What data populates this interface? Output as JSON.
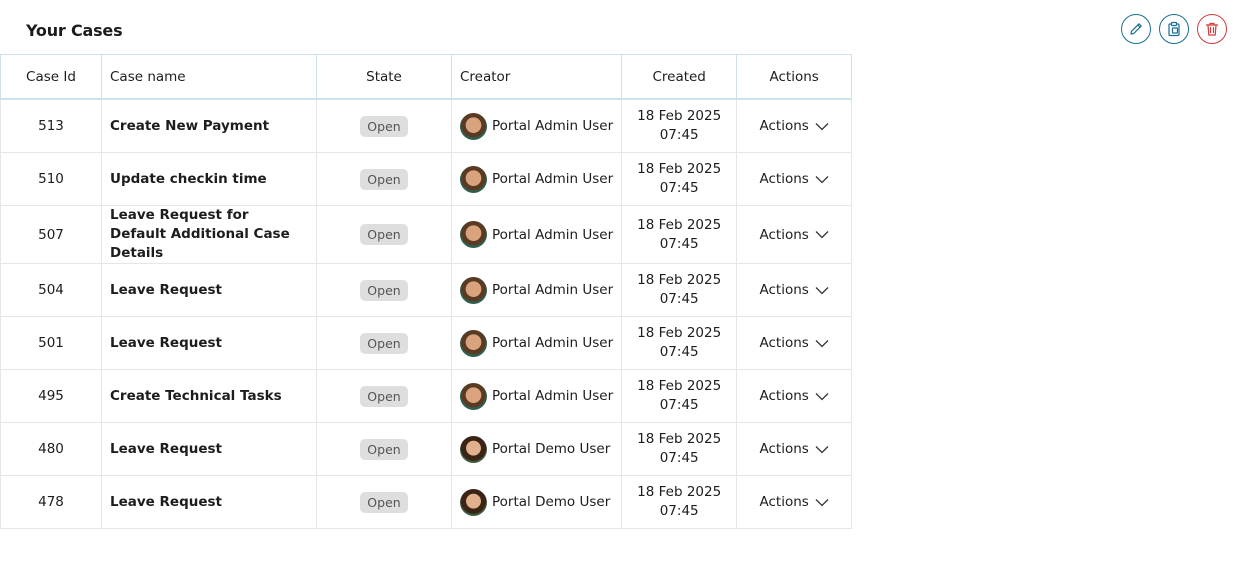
{
  "widget": {
    "title": "Your Cases",
    "toolbar": {
      "edit_icon": "pencil-icon",
      "clipboard_icon": "clipboard-icon",
      "delete_icon": "trash-icon",
      "accent_color": "#1a6f93",
      "danger_color": "#d43b3b"
    }
  },
  "table": {
    "headers": [
      "Case Id",
      "Case name",
      "State",
      "Creator",
      "Created",
      "Actions"
    ],
    "rows": [
      {
        "id": "513",
        "name": "Create New Payment",
        "state": "Open",
        "creator": "Portal Admin User",
        "date": "18 Feb 2025",
        "time": "07:45",
        "action": "Actions",
        "avatar": "admin"
      },
      {
        "id": "510",
        "name": "Update checkin time",
        "state": "Open",
        "creator": "Portal Admin User",
        "date": "18 Feb 2025",
        "time": "07:45",
        "action": "Actions",
        "avatar": "admin"
      },
      {
        "id": "507",
        "name": "Leave Request for Default Additional Case Details",
        "state": "Open",
        "creator": "Portal Admin User",
        "date": "18 Feb 2025",
        "time": "07:45",
        "action": "Actions",
        "avatar": "admin"
      },
      {
        "id": "504",
        "name": "Leave Request",
        "state": "Open",
        "creator": "Portal Admin User",
        "date": "18 Feb 2025",
        "time": "07:45",
        "action": "Actions",
        "avatar": "admin"
      },
      {
        "id": "501",
        "name": "Leave Request",
        "state": "Open",
        "creator": "Portal Admin User",
        "date": "18 Feb 2025",
        "time": "07:45",
        "action": "Actions",
        "avatar": "admin"
      },
      {
        "id": "495",
        "name": "Create Technical Tasks",
        "state": "Open",
        "creator": "Portal Admin User",
        "date": "18 Feb 2025",
        "time": "07:45",
        "action": "Actions",
        "avatar": "admin"
      },
      {
        "id": "480",
        "name": "Leave Request",
        "state": "Open",
        "creator": "Portal Demo User",
        "date": "18 Feb 2025",
        "time": "07:45",
        "action": "Actions",
        "avatar": "demo"
      },
      {
        "id": "478",
        "name": "Leave Request",
        "state": "Open",
        "creator": "Portal Demo User",
        "date": "18 Feb 2025",
        "time": "07:45",
        "action": "Actions",
        "avatar": "demo"
      }
    ]
  }
}
